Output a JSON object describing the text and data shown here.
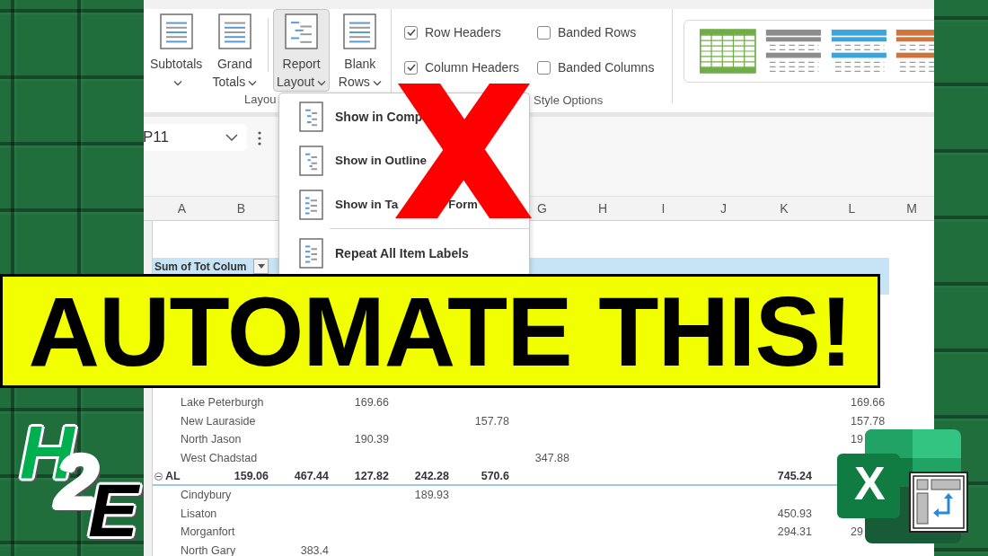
{
  "ribbon": {
    "groups": [
      {
        "label": "Layou",
        "buttons": [
          {
            "label": "Subtotals",
            "kind": "subtotals",
            "menu": true,
            "pressed": false
          },
          {
            "label": "Grand Totals",
            "kind": "totals",
            "menu": true,
            "pressed": false
          },
          {
            "label": "Report Layout",
            "kind": "report",
            "menu": true,
            "pressed": true
          },
          {
            "label": "Blank Rows",
            "kind": "blank",
            "menu": true,
            "pressed": false
          }
        ]
      },
      {
        "label": "Style Options",
        "options": [
          {
            "label": "Row Headers",
            "checked": true
          },
          {
            "label": "Column Headers",
            "checked": true
          },
          {
            "label": "Banded Rows",
            "checked": false
          },
          {
            "label": "Banded Columns",
            "checked": false
          }
        ]
      }
    ],
    "styles": [
      {
        "kind": "grid",
        "color": "#70ad47"
      },
      {
        "kind": "banded",
        "color": "#8c8c8c"
      },
      {
        "kind": "banded",
        "color": "#3aa6de"
      },
      {
        "kind": "banded",
        "color": "#d0743c"
      }
    ]
  },
  "name_box": {
    "value": "P11"
  },
  "column_headers": {
    "left": [
      "A",
      "B"
    ],
    "right": [
      "G",
      "H",
      "I",
      "J",
      "K",
      "L",
      "M"
    ]
  },
  "pivot": {
    "header": "Sum of Tot Colum"
  },
  "rows": [
    {
      "label": "Lake Peterburgh",
      "kind": "item",
      "cells": {
        "col_d": "169.66",
        "col_l": "169.66"
      }
    },
    {
      "label": "New Lauraside",
      "kind": "item",
      "cells": {
        "col_f": "157.78",
        "col_l": "157.78"
      }
    },
    {
      "label": "North Jason",
      "kind": "item",
      "cells": {
        "col_d": "190.39",
        "col_l": "19"
      }
    },
    {
      "label": "West Chadstad",
      "kind": "item",
      "cells": {
        "col_g": "347.88"
      }
    },
    {
      "label": "AL",
      "kind": "group",
      "expanded": true,
      "cells": {
        "col_b": "159.06",
        "col_c": "467.44",
        "col_d": "127.82",
        "col_e": "242.28",
        "col_f": "570.6",
        "col_k": "745.24"
      }
    },
    {
      "label": "Cindybury",
      "kind": "item",
      "cells": {
        "col_e": "189.93"
      }
    },
    {
      "label": "Lisaton",
      "kind": "item",
      "cells": {
        "col_k": "450.93"
      }
    },
    {
      "label": "Morganfort",
      "kind": "item",
      "cells": {
        "col_k": "294.31",
        "col_l": "29"
      }
    },
    {
      "label": "North Gary",
      "kind": "item",
      "cells": {
        "col_c": "383.4"
      }
    }
  ],
  "menu": {
    "items": [
      {
        "label": "Show in Comp",
        "kind": "compact",
        "separator_before": false
      },
      {
        "label": "Show in Outline",
        "kind": "outline",
        "separator_before": false
      },
      {
        "label": "Show in Ta",
        "tail": "Form",
        "kind": "tabular",
        "separator_before": false
      },
      {
        "label": "Repeat All Item Labels",
        "kind": "repeat",
        "separator_before": true
      }
    ]
  },
  "banner": {
    "text": "AUTOMATE THIS!"
  },
  "logo": {
    "letters": [
      {
        "char": "H",
        "color": "#00b050"
      },
      {
        "char": "2",
        "color": "#ffffff"
      },
      {
        "char": "E",
        "color": "#000000"
      }
    ]
  },
  "app_icon": {
    "letter": "X"
  }
}
